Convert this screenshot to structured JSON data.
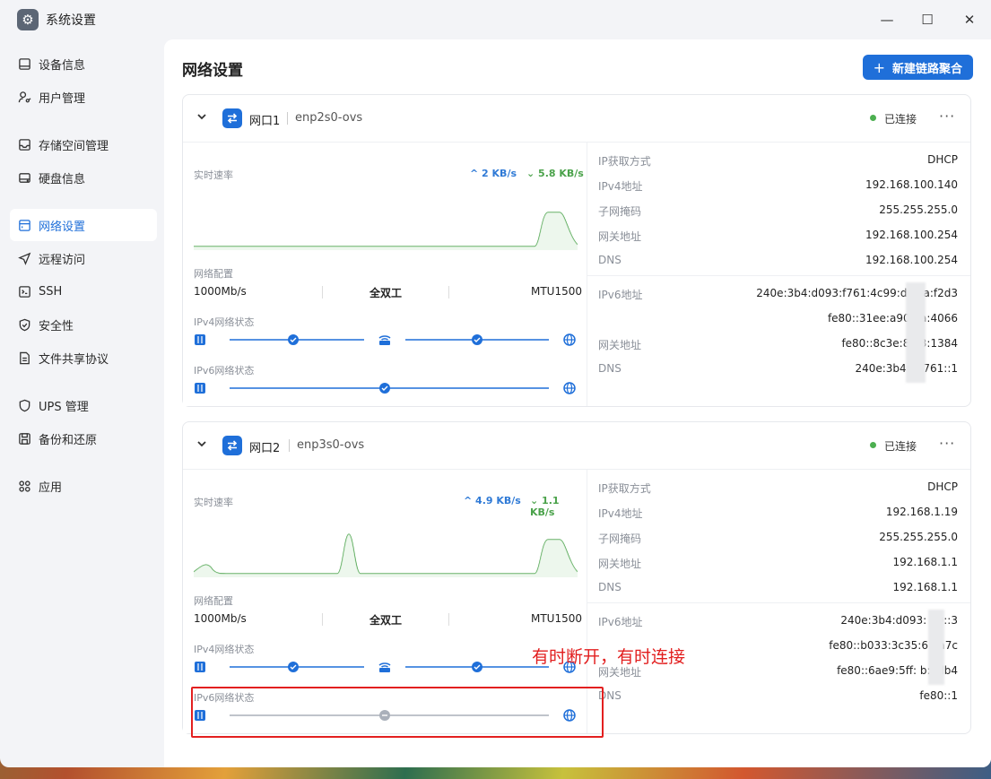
{
  "app": {
    "title": "系统设置"
  },
  "window_controls": {
    "minimize": "—",
    "maximize": "☐",
    "close": "✕"
  },
  "sidebar": {
    "items": [
      {
        "label": "设备信息",
        "icon": "monitor-icon"
      },
      {
        "label": "用户管理",
        "icon": "user-key-icon"
      },
      {
        "label": "存储空间管理",
        "icon": "storage-icon"
      },
      {
        "label": "硬盘信息",
        "icon": "disk-icon"
      },
      {
        "label": "网络设置",
        "icon": "network-icon",
        "active": true
      },
      {
        "label": "远程访问",
        "icon": "send-icon"
      },
      {
        "label": "SSH",
        "icon": "terminal-icon"
      },
      {
        "label": "安全性",
        "icon": "shield-icon"
      },
      {
        "label": "文件共享协议",
        "icon": "file-icon"
      },
      {
        "label": "UPS 管理",
        "icon": "ups-shield-icon"
      },
      {
        "label": "备份和还原",
        "icon": "backup-icon"
      },
      {
        "label": "应用",
        "icon": "apps-icon"
      }
    ]
  },
  "header": {
    "title": "网络设置",
    "new_button": "新建链路聚合",
    "plus": "+"
  },
  "ports": [
    {
      "name": "网口1",
      "device": "enp2s0-ovs",
      "status": "已连接",
      "more": "···",
      "speed_label": "实时速率",
      "upload": "^ 2 KB/s",
      "download": "⌄ 5.8 KB/s",
      "config_label": "网络配置",
      "link_speed": "1000Mb/s",
      "duplex": "全双工",
      "mtu": "MTU1500",
      "ipv4_label": "IPv4网络状态",
      "ipv6_label": "IPv6网络状态",
      "ipv6_ok": true,
      "info": [
        {
          "k": "IP获取方式",
          "v": "DHCP"
        },
        {
          "k": "IPv4地址",
          "v": "192.168.100.140"
        },
        {
          "k": "子网掩码",
          "v": "255.255.255.0"
        },
        {
          "k": "网关地址",
          "v": "192.168.100.254"
        },
        {
          "k": "DNS",
          "v": "192.168.100.254"
        }
      ],
      "ipv6": [
        {
          "k": "IPv6地址",
          "v": "240e:3b4:d093:f761:4c99:dc0    a:f2d3"
        },
        {
          "k": "",
          "v": "fe80::31ee:a909    a:4066"
        },
        {
          "k": "网关地址",
          "v": "fe80::8c3e:86      3:1384"
        },
        {
          "k": "DNS",
          "v": "240e:3b4:c     f761::1"
        }
      ]
    },
    {
      "name": "网口2",
      "device": "enp3s0-ovs",
      "status": "已连接",
      "more": "···",
      "speed_label": "实时速率",
      "upload": "^ 4.9 KB/s",
      "download": "⌄ 1.1 KB/s",
      "config_label": "网络配置",
      "link_speed": "1000Mb/s",
      "duplex": "全双工",
      "mtu": "MTU1500",
      "ipv4_label": "IPv4网络状态",
      "ipv6_label": "IPv6网络状态",
      "ipv6_ok": false,
      "info": [
        {
          "k": "IP获取方式",
          "v": "DHCP"
        },
        {
          "k": "IPv4地址",
          "v": "192.168.1.19"
        },
        {
          "k": "子网掩码",
          "v": "255.255.255.0"
        },
        {
          "k": "网关地址",
          "v": "192.168.1.1"
        },
        {
          "k": "DNS",
          "v": "192.168.1.1"
        }
      ],
      "ipv6": [
        {
          "k": "IPv6地址",
          "v": "240e:3b4:d093:    60::3"
        },
        {
          "k": "",
          "v": "fe80::b033:3c35:6    5a7c"
        },
        {
          "k": "网关地址",
          "v": "fe80::6ae9:5ff:    b:7db4"
        },
        {
          "k": "DNS",
          "v": "fe80::1"
        }
      ]
    }
  ],
  "annotation": "有时断开，有时连接",
  "colors": {
    "accent": "#1f6fd9",
    "ok": "#4caf50",
    "upload": "#2f7ad6",
    "download": "#4aa24a",
    "annotation": "#e21e1e"
  }
}
